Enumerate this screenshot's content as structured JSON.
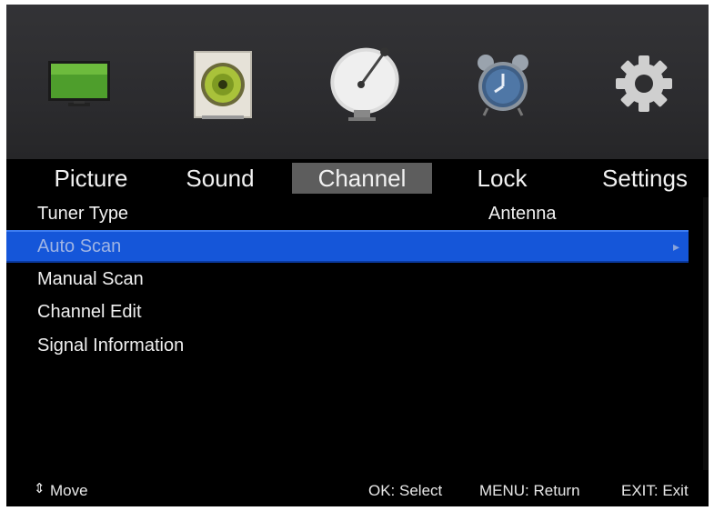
{
  "tabs": [
    {
      "label": "Picture",
      "icon": "tv-icon"
    },
    {
      "label": "Sound",
      "icon": "speaker-icon"
    },
    {
      "label": "Channel",
      "icon": "satellite-dish-icon"
    },
    {
      "label": "Lock",
      "icon": "alarm-clock-icon"
    },
    {
      "label": "Settings",
      "icon": "gear-icon"
    }
  ],
  "active_tab": "Channel",
  "menu": {
    "items": [
      {
        "label": "Tuner Type",
        "value": "Antenna"
      },
      {
        "label": "Auto Scan",
        "value": ""
      },
      {
        "label": "Manual Scan",
        "value": ""
      },
      {
        "label": "Channel Edit",
        "value": ""
      },
      {
        "label": "Signal Information",
        "value": ""
      }
    ],
    "selected": "Auto Scan"
  },
  "footer": {
    "move": "Move",
    "ok": "OK: Select",
    "menu": "MENU: Return",
    "exit": "EXIT: Exit"
  },
  "colors": {
    "selection": "#1556d9",
    "active_tab": "#5d5d5d",
    "background": "#000000"
  }
}
